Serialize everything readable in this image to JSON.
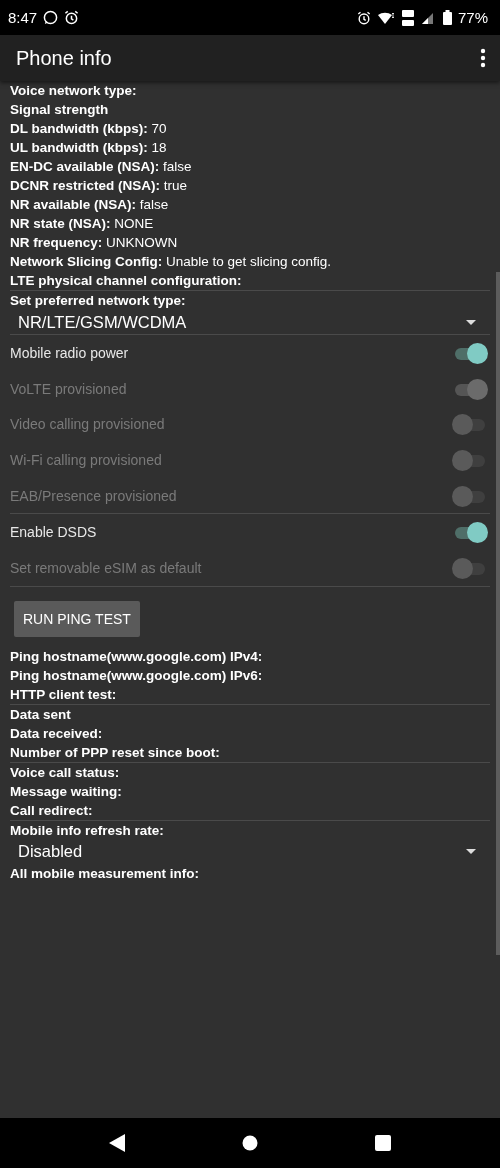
{
  "status_bar": {
    "time": "8:47",
    "battery": "77%"
  },
  "app_bar": {
    "title": "Phone info"
  },
  "blocks": [
    {
      "kind": "info",
      "rows": [
        {
          "label": "Voice network type:"
        },
        {
          "label": "Signal strength"
        },
        {
          "label": "DL bandwidth (kbps):",
          "value": "70"
        },
        {
          "label": "UL bandwidth (kbps):",
          "value": "18"
        },
        {
          "label": "EN-DC available (NSA):",
          "value": "false"
        },
        {
          "label": "DCNR restricted (NSA):",
          "value": "true"
        },
        {
          "label": "NR available (NSA):",
          "value": "false"
        },
        {
          "label": "NR state (NSA):",
          "value": "NONE"
        },
        {
          "label": "NR frequency:",
          "value": "UNKNOWN"
        },
        {
          "label": "Network Slicing Config:",
          "value": "Unable to get slicing config."
        },
        {
          "label": "LTE physical channel configuration:"
        }
      ]
    },
    {
      "kind": "divider"
    },
    {
      "kind": "select",
      "label": "Set preferred network type:",
      "value": "NR/LTE/GSM/WCDMA"
    },
    {
      "kind": "divider"
    },
    {
      "kind": "toggles",
      "items": [
        {
          "label": "Mobile radio power",
          "on": true,
          "disabled": false
        },
        {
          "label": "VoLTE provisioned",
          "on": true,
          "disabled": true
        },
        {
          "label": "Video calling provisioned",
          "on": false,
          "disabled": true
        },
        {
          "label": "Wi-Fi calling provisioned",
          "on": false,
          "disabled": true
        },
        {
          "label": "EAB/Presence provisioned",
          "on": false,
          "disabled": true
        }
      ]
    },
    {
      "kind": "divider"
    },
    {
      "kind": "toggles",
      "items": [
        {
          "label": "Enable DSDS",
          "on": true,
          "disabled": false
        },
        {
          "label": "Set removable eSIM as default",
          "on": false,
          "disabled": true
        }
      ]
    },
    {
      "kind": "divider"
    },
    {
      "kind": "button",
      "label": "RUN PING TEST"
    },
    {
      "kind": "info",
      "rows": [
        {
          "label": "Ping hostname(www.google.com) IPv4:"
        },
        {
          "label": "Ping hostname(www.google.com) IPv6:"
        },
        {
          "label": "HTTP client test:"
        }
      ]
    },
    {
      "kind": "divider"
    },
    {
      "kind": "info",
      "rows": [
        {
          "label": "Data sent"
        },
        {
          "label": "Data received:"
        },
        {
          "label": "Number of PPP reset since boot:"
        }
      ]
    },
    {
      "kind": "divider"
    },
    {
      "kind": "info",
      "rows": [
        {
          "label": "Voice call status:"
        },
        {
          "label": "Message waiting:"
        },
        {
          "label": "Call redirect:"
        }
      ]
    },
    {
      "kind": "divider"
    },
    {
      "kind": "select",
      "label": "Mobile info refresh rate:",
      "value": "Disabled"
    },
    {
      "kind": "info",
      "rows": [
        {
          "label": "All mobile measurement info:"
        }
      ]
    }
  ]
}
